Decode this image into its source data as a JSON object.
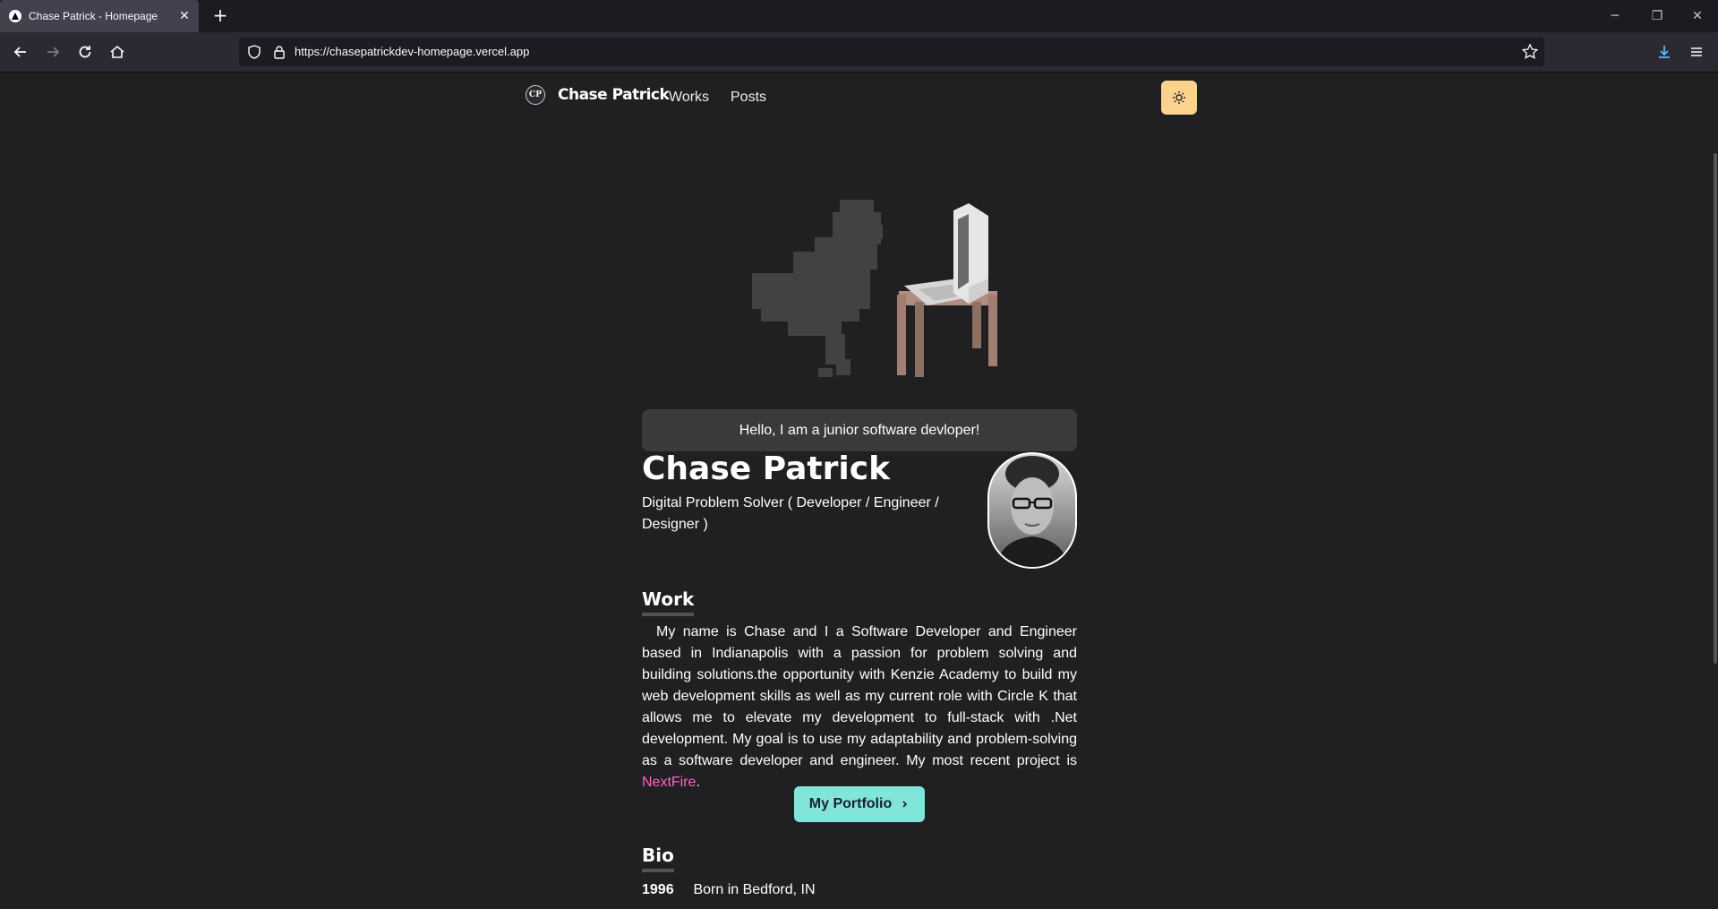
{
  "browser": {
    "tab_title": "Chase Patrick - Homepage",
    "url": "https://chasepatrickdev-homepage.vercel.app"
  },
  "site_nav": {
    "logo_initials": "CP",
    "logo_name": "Chase Patrick",
    "links": [
      "Works",
      "Posts"
    ],
    "theme_icon": "sun-icon"
  },
  "hero": {
    "greeting": "Hello, I am a junior software devloper!",
    "name": "Chase Patrick",
    "subtitle": "Digital Problem Solver ( Developer / Engineer / Designer )"
  },
  "work": {
    "heading": "Work",
    "paragraph": "My name is Chase and I a Software Developer and Engineer based in Indianapolis with a passion for problem solving and building solutions.the opportunity with Kenzie Academy to build my web development skills as well as my current role with Circle K that allows me to elevate my development to full-stack with .Net development. My goal is to use my adaptability and problem-solving as a software developer and engineer. My most recent project is",
    "link_text": "NextFire",
    "trailing": ".",
    "button_label": "My Portfolio",
    "button_icon": "chevron-right-icon"
  },
  "bio": {
    "heading": "Bio",
    "entries": [
      {
        "year": "1996",
        "text": "Born in Bedford, IN"
      }
    ]
  },
  "colors": {
    "background": "#202023",
    "accent_teal": "#81e6d9",
    "link_pink": "#ff63c3",
    "toggle_yellow": "#fbd38d"
  }
}
